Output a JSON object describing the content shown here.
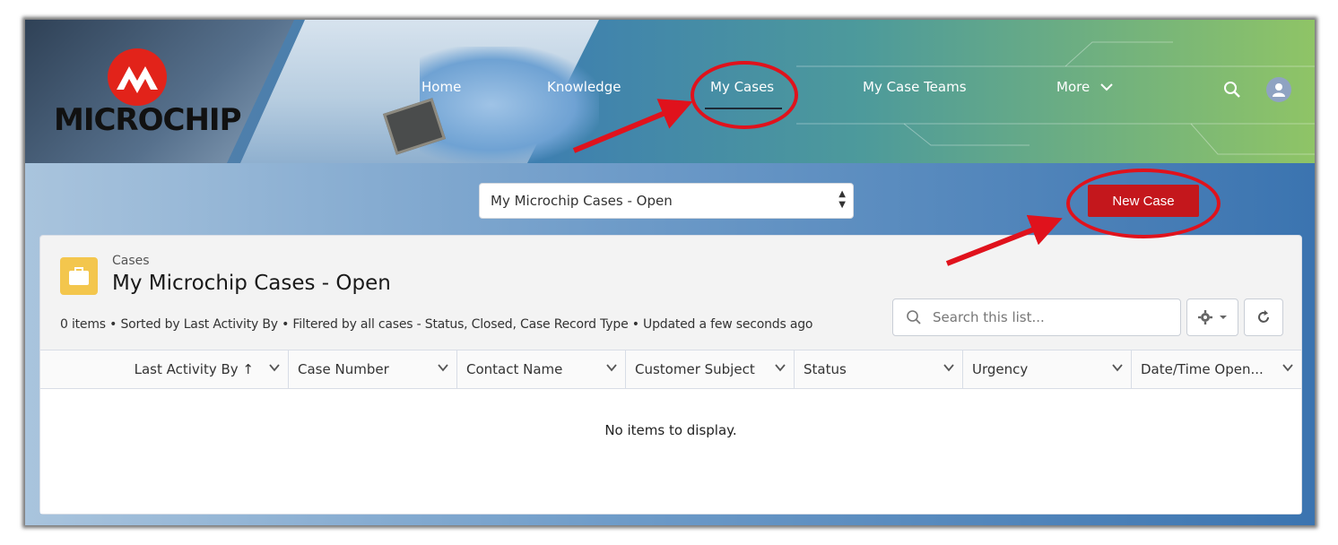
{
  "brand": {
    "logo_text": "MICROCHIP"
  },
  "nav": {
    "items": [
      {
        "label": "Home"
      },
      {
        "label": "Knowledge"
      },
      {
        "label": "My Cases"
      },
      {
        "label": "My Case Teams"
      },
      {
        "label": "More"
      }
    ],
    "active": "My Cases"
  },
  "header_icons": [
    "search-icon",
    "user-avatar-icon"
  ],
  "list_view": {
    "selected": "My Microchip Cases - Open"
  },
  "actions": {
    "new_case_label": "New Case"
  },
  "card": {
    "object_label": "Cases",
    "title": "My Microchip Cases - Open",
    "meta": "0 items • Sorted by Last Activity By • Filtered by all cases - Status, Closed, Case Record Type • Updated a few seconds ago",
    "search_placeholder": "Search this list...",
    "columns": [
      {
        "label": "Last Activity By ↑"
      },
      {
        "label": "Case Number"
      },
      {
        "label": "Contact Name"
      },
      {
        "label": "Customer Subject"
      },
      {
        "label": "Status"
      },
      {
        "label": "Urgency"
      },
      {
        "label": "Date/Time Open..."
      }
    ],
    "empty_message": "No items to display."
  },
  "colors": {
    "accent_red": "#c4171c",
    "annotation_red": "#e0121c",
    "card_icon_yellow": "#f3c64d"
  }
}
